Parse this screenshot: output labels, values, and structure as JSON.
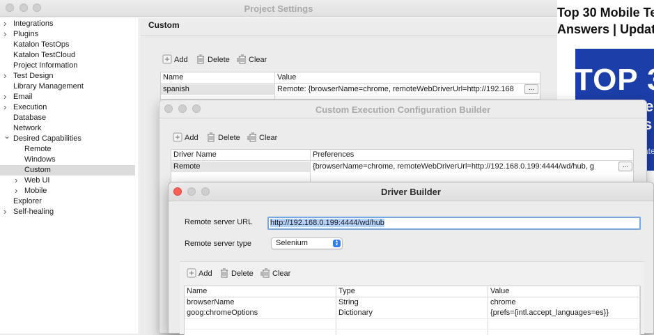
{
  "web_page": {
    "title_line1": "Top 30 Mobile Te",
    "title_line2": "Answers | Update",
    "banner_text": "TOP 3",
    "banner_frag1": "e",
    "banner_frag2": "s",
    "banner_frag3": "ate",
    "banner_color": "#1b3ea8"
  },
  "project_settings": {
    "window_title": "Project Settings",
    "section_heading": "Custom",
    "tree": [
      {
        "label": "Integrations",
        "expandable": true
      },
      {
        "label": "Plugins",
        "expandable": true
      },
      {
        "label": "Katalon TestOps",
        "expandable": false
      },
      {
        "label": "Katalon TestCloud",
        "expandable": false
      },
      {
        "label": "Project Information",
        "expandable": false
      },
      {
        "label": "Test Design",
        "expandable": true
      },
      {
        "label": "Library Management",
        "expandable": false
      },
      {
        "label": "Email",
        "expandable": true
      },
      {
        "label": "Execution",
        "expandable": true
      },
      {
        "label": "Database",
        "expandable": false
      },
      {
        "label": "Network",
        "expandable": false
      },
      {
        "label": "Desired Capabilities",
        "expandable": true,
        "expanded": true
      },
      {
        "label": "Remote",
        "expandable": false
      },
      {
        "label": "Windows",
        "expandable": false
      },
      {
        "label": "Custom",
        "expandable": false,
        "selected": true
      },
      {
        "label": "Web UI",
        "expandable": true
      },
      {
        "label": "Mobile",
        "expandable": true
      },
      {
        "label": "Explorer",
        "expandable": false
      },
      {
        "label": "Self-healing",
        "expandable": true
      }
    ],
    "toolbar": {
      "add": "Add",
      "delete": "Delete",
      "clear": "Clear"
    },
    "columns": [
      "Name",
      "Value"
    ],
    "rows": [
      {
        "name": "spanish",
        "value": "Remote: {browserName=chrome, remoteWebDriverUrl=http://192.168"
      }
    ],
    "ellipsis": "..."
  },
  "custom_builder": {
    "window_title": "Custom Execution Configuration Builder",
    "toolbar": {
      "add": "Add",
      "delete": "Delete",
      "clear": "Clear"
    },
    "columns": [
      "Driver Name",
      "Preferences"
    ],
    "rows": [
      {
        "name": "Remote",
        "value": "{browserName=chrome, remoteWebDriverUrl=http://192.168.0.199:4444/wd/hub, g"
      }
    ],
    "ellipsis": "..."
  },
  "driver_builder": {
    "window_title": "Driver Builder",
    "url_label": "Remote server URL",
    "url_value": "http://192.168.0.199:4444/wd/hub",
    "type_label": "Remote server type",
    "type_value": "Selenium",
    "toolbar": {
      "add": "Add",
      "delete": "Delete",
      "clear": "Clear"
    },
    "columns": [
      "Name",
      "Type",
      "Value"
    ],
    "rows": [
      {
        "name": "browserName",
        "type": "String",
        "value": "chrome"
      },
      {
        "name": "goog:chromeOptions",
        "type": "Dictionary",
        "value": "{prefs={intl.accept_languages=es}}"
      }
    ]
  },
  "colors": {
    "close_red": "#ff5f57",
    "minimize_yellow": "#febc2e",
    "zoom_green": "#28c840",
    "selection_highlight": "#b3d3fb",
    "select_accent": "#2f7cf6"
  }
}
